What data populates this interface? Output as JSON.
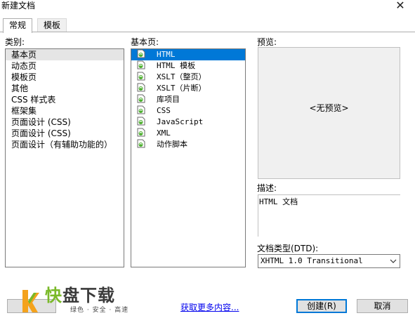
{
  "window": {
    "title": "新建文档",
    "close_glyph": "✕"
  },
  "tabs": [
    {
      "label": "常规",
      "active": true
    },
    {
      "label": "模板",
      "active": false
    }
  ],
  "category": {
    "label": "类别:",
    "items": [
      "基本页",
      "动态页",
      "模板页",
      "其他",
      "CSS 样式表",
      "框架集",
      "页面设计 (CSS)",
      "页面设计 (CSS)",
      "页面设计（有辅助功能的）"
    ],
    "selected_index": 0
  },
  "basic_page": {
    "label": "基本页:",
    "items": [
      "HTML",
      "HTML 模板",
      "XSLT（整页）",
      "XSLT（片断）",
      "库项目",
      "CSS",
      "JavaScript",
      "XML",
      "动作脚本"
    ],
    "selected_index": 0,
    "icon": "dreamweaver-doc-icon"
  },
  "preview": {
    "label": "预览:",
    "text": "<无预览>"
  },
  "description": {
    "label": "描述:",
    "text": "HTML 文档"
  },
  "doctype": {
    "label": "文档类型(DTD):",
    "value": "XHTML 1.0 Transitional"
  },
  "footer": {
    "more_link": "获取更多内容...",
    "create_button": "创建(R)",
    "cancel_button": "取消"
  },
  "watermark": {
    "brand_green": "快",
    "brand_dark": "盘下载",
    "slogan": "绿色 · 安全 · 高速"
  },
  "colors": {
    "selection": "#0078d7",
    "brand_green": "#7ab929",
    "link": "#0000ee"
  }
}
